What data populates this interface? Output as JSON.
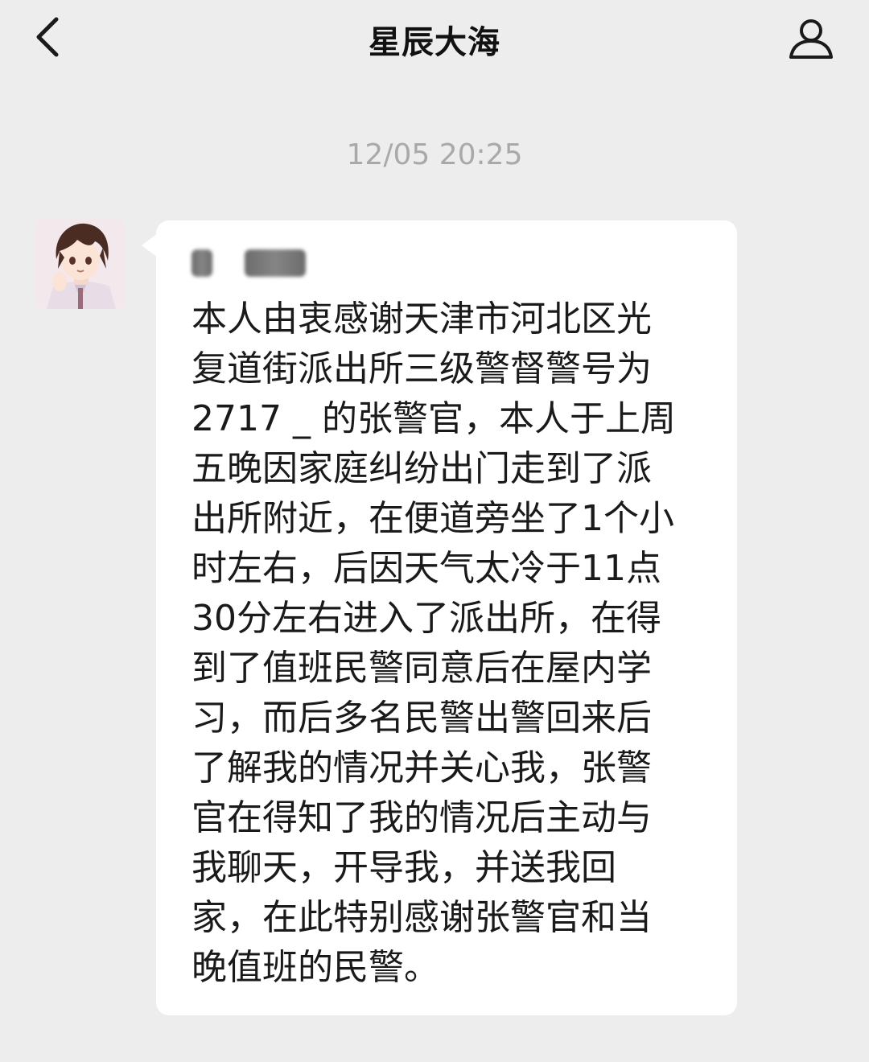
{
  "nav": {
    "title": "星辰大海",
    "back_icon": "chevron-left-icon",
    "profile_icon": "person-icon"
  },
  "chat": {
    "timestamp": "12/05 20:25",
    "message": {
      "avatar": "anime-boy-avatar",
      "sender_redacted": true,
      "text": "本人由衷感谢天津市河北区光\n复道街派出所三级警督警号为\n2717 _ 的张警官，本人于上周\n五晚因家庭纠纷出门走到了派\n出所附近，在便道旁坐了1个小\n时左右，后因天气太冷于11点\n30分左右进入了派出所，在得\n到了值班民警同意后在屋内学\n习，而后多名民警出警回来后\n了解我的情况并关心我，张警\n官在得知了我的情况后主动与\n我聊天，开导我，并送我回\n家，在此特别感谢张警官和当\n晚值班的民警。"
    }
  },
  "colors": {
    "background": "#ededed",
    "bubble": "#ffffff",
    "timestamp": "#a9a9a9",
    "text": "#1a1a1a"
  }
}
